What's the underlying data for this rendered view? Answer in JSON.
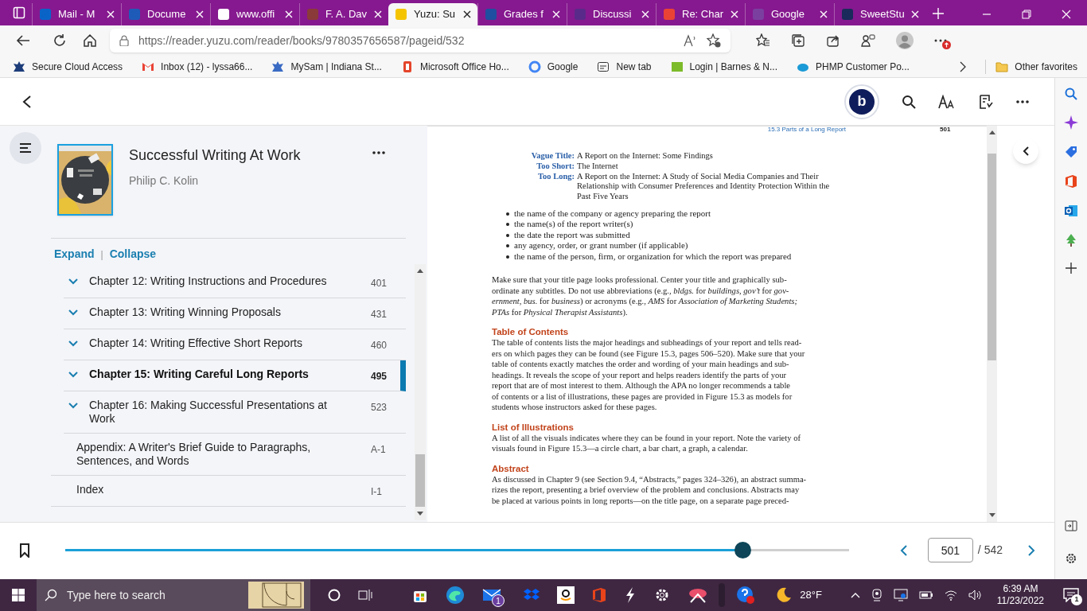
{
  "browser": {
    "tabs": [
      {
        "title": "Mail - M",
        "selected": false
      },
      {
        "title": "Docume",
        "selected": false
      },
      {
        "title": "www.offi",
        "selected": false
      },
      {
        "title": "F. A. Dav",
        "selected": false
      },
      {
        "title": "Yuzu: Su",
        "selected": true
      },
      {
        "title": "Grades f",
        "selected": false
      },
      {
        "title": "Discussi",
        "selected": false
      },
      {
        "title": "Re: Char",
        "selected": false
      },
      {
        "title": "Google",
        "selected": false
      },
      {
        "title": "SweetStu",
        "selected": false
      }
    ],
    "address": "https://reader.yuzu.com/reader/books/9780357656587/pageid/532",
    "bookmarks": [
      "Secure Cloud Access",
      "Inbox (12) - lyssa66...",
      "MySam | Indiana St...",
      "Microsoft Office Ho...",
      "Google",
      "New tab",
      "Login | Barnes & N...",
      "PHMP Customer Po..."
    ],
    "other_favorites": "Other favorites"
  },
  "reader": {
    "avatar": "b"
  },
  "book": {
    "title": "Successful Writing At Work",
    "author": "Philip C. Kolin"
  },
  "toc": {
    "expand": "Expand",
    "separator": "|",
    "collapse": "Collapse",
    "items": [
      {
        "label": "Chapter 12: Writing Instructions and Procedures",
        "page": "401",
        "kind": "chapter",
        "selected": false
      },
      {
        "label": "Chapter 13: Writing Winning Proposals",
        "page": "431",
        "kind": "chapter",
        "selected": false
      },
      {
        "label": "Chapter 14: Writing Effective Short Reports",
        "page": "460",
        "kind": "chapter",
        "selected": false
      },
      {
        "label": "Chapter 15: Writing Careful Long Reports",
        "page": "495",
        "kind": "chapter",
        "selected": true
      },
      {
        "label": "Chapter 16: Making Successful Presentations at Work",
        "page": "523",
        "kind": "chapter",
        "selected": false
      },
      {
        "label": "Appendix: A Writer's Brief Guide to Paragraphs, Sentences, and Words",
        "page": "A-1",
        "kind": "section",
        "selected": false
      },
      {
        "label": "Index",
        "page": "I-1",
        "kind": "section",
        "selected": false
      }
    ]
  },
  "page": {
    "running_head": "15.3 Parts of a Long Report",
    "number": "501",
    "examples": [
      {
        "label": "Vague Title:",
        "text": "A Report on the Internet: Some Findings"
      },
      {
        "label": "Too Short:",
        "text": "The Internet"
      },
      {
        "label": "Too Long:",
        "text": "A Report on the Internet: A Study of Social Media Companies and Their\nRelationship with Consumer Preferences and Identity Protection Within the\nPast Five Years"
      }
    ],
    "bullets": [
      "the name of the company or agency preparing the report",
      "the name(s) of the report writer(s)",
      "the date the report was submitted",
      "any agency, order, or grant number (if applicable)",
      "the name of the person, firm, or organization for which the report was prepared"
    ],
    "sections": [
      {
        "text": "Make sure that your title page looks professional. Center your title and graphically sub-\nordinate any subtitles. Do not use abbreviations (e.g., *bldgs.* for *buildings*, *gov’t* for *gov-*\n*ernment*, *bus.* for *business*) or acronyms (e.g., *AMS* for *Association of Marketing Students;*\n*PTAs* for *Physical Therapist Assistants*)."
      },
      {
        "heading": "Table of Contents",
        "text": "The table of contents lists the major headings and subheadings of your report and tells read-\ners on which pages they can be found (see Figure 15.3, pages 506–520). Make sure that your\ntable of contents exactly matches the order and wording of your main headings and sub-\nheadings. It reveals the scope of your report and helps readers identify the parts of your\nreport that are of most interest to them. Although the APA no longer recommends a table\nof contents or a list of illustrations, these pages are provided in Figure 15.3 as models for\nstudents whose instructors asked for these pages."
      },
      {
        "heading": "List of Illustrations",
        "text": "A list of all the visuals indicates where they can be found in your report. Note the variety of\nvisuals found in Figure 15.3—a circle chart, a bar chart, a graph, a calendar."
      },
      {
        "heading": "Abstract",
        "text": "As discussed in Chapter 9 (see Section 9.4, “Abstracts,” pages 324–326), an abstract summa-\nrizes the report, presenting a brief overview of the problem and conclusions. Abstracts may\nbe placed at various points in long reports—on the title page, on a separate page preced-"
      }
    ]
  },
  "navigator": {
    "level": 0.873,
    "page_input": "501",
    "total": "/ 542"
  },
  "taskbar": {
    "search_placeholder": "Type here to search",
    "mail_badge": "1",
    "weather": "28°F",
    "time": "6:39 AM",
    "date": "11/23/2022",
    "notification_count": "1"
  }
}
